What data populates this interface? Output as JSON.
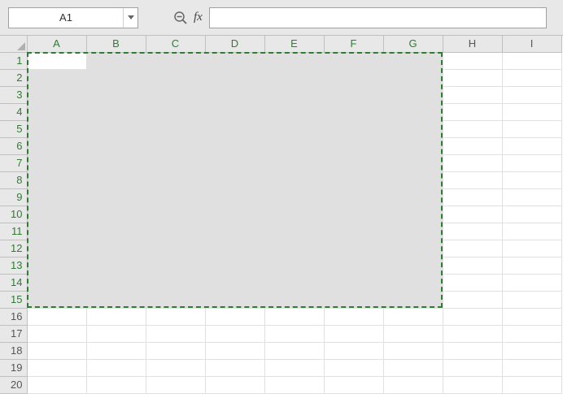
{
  "toolbar": {
    "namebox_value": "A1",
    "fx_label": "fx",
    "formula_value": ""
  },
  "columns": [
    "A",
    "B",
    "C",
    "D",
    "E",
    "F",
    "G",
    "H",
    "I"
  ],
  "rows": [
    "1",
    "2",
    "3",
    "4",
    "5",
    "6",
    "7",
    "8",
    "9",
    "10",
    "11",
    "12",
    "13",
    "14",
    "15",
    "16",
    "17",
    "18",
    "19",
    "20"
  ],
  "selection": {
    "from_col": 0,
    "to_col": 6,
    "from_row": 0,
    "to_row": 14,
    "active": {
      "col": 0,
      "row": 0
    }
  }
}
